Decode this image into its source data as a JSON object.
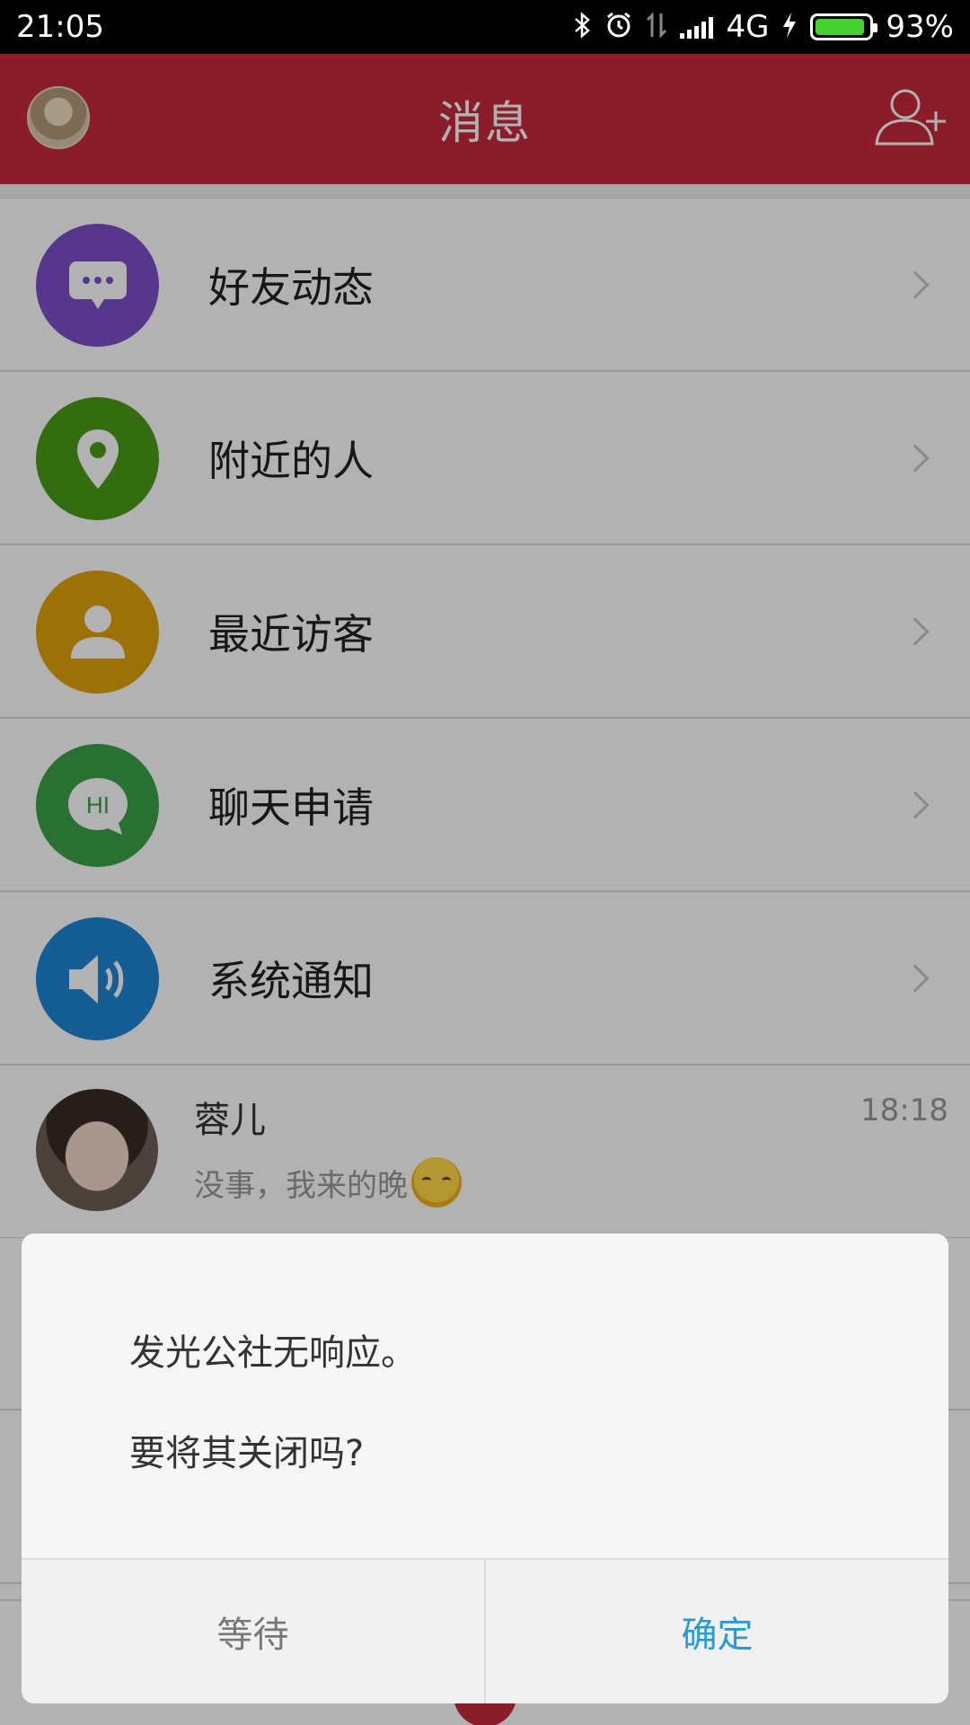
{
  "status_bar": {
    "time": "21:05",
    "network": "4G",
    "battery_percent_text": "93%",
    "battery_level": 0.93
  },
  "header": {
    "title": "消息"
  },
  "menu": [
    {
      "label": "好友动态",
      "icon": "chat-bubble-icon",
      "color": "#7b4fc9"
    },
    {
      "label": "附近的人",
      "icon": "location-pin-icon",
      "color": "#4a9c17"
    },
    {
      "label": "最近访客",
      "icon": "person-icon",
      "color": "#e0a20b"
    },
    {
      "label": "聊天申请",
      "icon": "hi-bubble-icon",
      "color": "#3aa24a"
    },
    {
      "label": "系统通知",
      "icon": "speaker-icon",
      "color": "#1e86d6"
    }
  ],
  "conversation": {
    "name": "蓉儿",
    "time": "18:18",
    "message": "没事，我来的晚",
    "emoji": "smiling-emoji"
  },
  "dialog": {
    "line1": "发光公社无响应。",
    "line2": "要将其关闭吗?",
    "wait_label": "等待",
    "ok_label": "确定"
  },
  "colors": {
    "header": "#c72a3d",
    "dialog_ok": "#2a9ad6"
  }
}
